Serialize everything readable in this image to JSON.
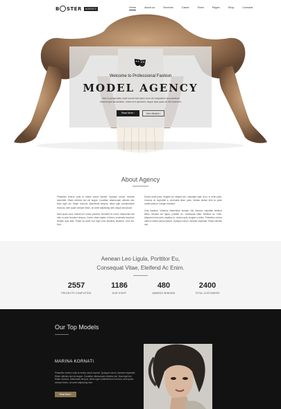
{
  "nav": {
    "logo_prefix": "B",
    "logo_suffix": "STER",
    "logo_badge": "AGENCY",
    "items": [
      {
        "label": "Home",
        "active": true
      },
      {
        "label": "About us",
        "active": false
      },
      {
        "label": "Services",
        "active": false
      },
      {
        "label": "Cases",
        "active": false
      },
      {
        "label": "Team",
        "active": false
      },
      {
        "label": "Pages",
        "active": false
      },
      {
        "label": "Shop",
        "active": false
      },
      {
        "label": "Contacts",
        "active": false
      }
    ]
  },
  "hero": {
    "icon": "theater-masks-icon",
    "welcome": "Welcome to Professional Fashion",
    "title": "MODEL AGENCY",
    "desc": "Sed ut perspiciatis unde omnis iste natus error sit voluptatem accusantium doloremque laudantium, totam rem aperiam, eaque ipsa quae ab illo inventore.",
    "read_more": "Read More  ›",
    "view_models": "View Models  ›"
  },
  "about": {
    "title": "About Agency",
    "col1": [
      "Phasellus viverra nulla ut metus varius laoreet. Quisque rutrum. Aenean imperdiet. Etiam ultricies nisi vel augue. Curabitur ullamcorper ultricies nisi. Nam eget dui. Etiam rhoncus. Maecenas tempus, tellus eget condimentum rhoncus, sem quam semper libero, sit amet adipiscing sem neque sed ipsum.",
      "Nam quam nunc, blandit vel, luctus pulvinar, hendrerit id, lorem. Maecenas nec odio et ante tincidunt tempus. Donec vitae sapien ut libero venenatis faucibus. Nullam quis ante. Etiam sit amet orci eget eros faucibus tincidunt. Duis leo. Sed."
    ],
    "col2": [
      "Donec pede justo, fringilla vel, aliquet nec, vulputate eget, arcu. In enim justo, rhoncus ut, imperdiet a, venenatis vitae, justo. Nullam dictum felis eu pede mollis pretium. Integer tincidunt.",
      "Cras dapibus. Vivamus elementum semper nisi. Aenean vulputate eleifend tellus. Aenean leo ligula, porttitor eu, consequat vitae, eleifend ac, enim. Aliquam lorem ante, dapibus in, viverra quis, feugiat a, tellus. Phasellus viverra nulla ut metus varius laoreet. Quisque rutrum. Aenean imperdiet. Etiam ultricies nisi."
    ]
  },
  "quote": {
    "line1": "Aenean Leo Ligula, Porttitor Eu,",
    "line2": "Consequat Vitae, Eleifend Ac Enim."
  },
  "stats": [
    {
      "value": "2557",
      "label": "PROJECTS COMPLETED"
    },
    {
      "value": "1186",
      "label": "OUR STAFF"
    },
    {
      "value": "480",
      "label": "AWARDS WINNING"
    },
    {
      "value": "2400",
      "label": "TOTAL CUSTOMERS"
    }
  ],
  "models": {
    "title": "Our Top Models",
    "name": "MARINA KORNATI",
    "desc": "Phasellus viverra nulla ut metus varius laoreet. Quisque rutrum. Aenean imperdiet. Etiam ultricies nisi vel augue. Curabitur ullamcorper ultricies nisi. Nam eget dui. Etiam rhoncus. Maecenas tempus, tellus eget condimentum rhoncus, sem quam semper libero, sit amet adipiscing sem.",
    "button": "Read More  ›"
  },
  "colors": {
    "accent": "#8a7550",
    "dark_section": "#121212",
    "light_section": "#f5f5f5"
  }
}
